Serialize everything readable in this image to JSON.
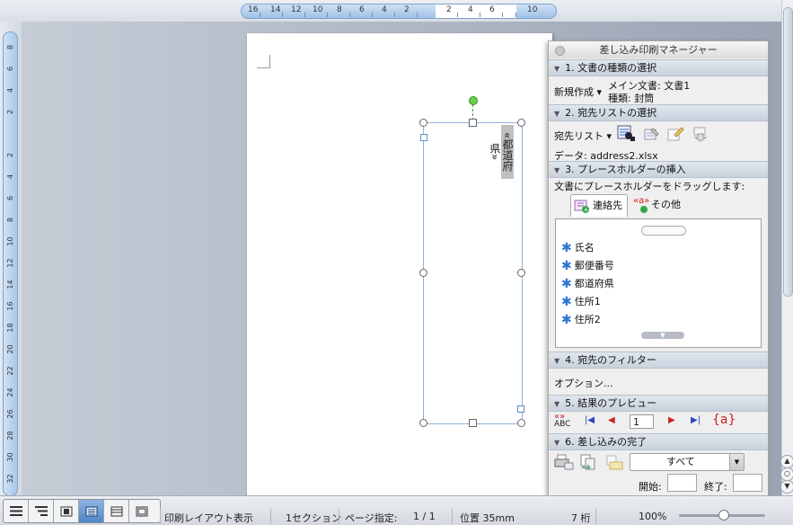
{
  "ruler": {
    "h_labels": [
      "16",
      "14",
      "12",
      "10",
      "8",
      "6",
      "4",
      "2",
      "2",
      "4",
      "6",
      "10"
    ],
    "v_labels": [
      "8",
      "6",
      "4",
      "2",
      "2",
      "4",
      "6",
      "8",
      "10",
      "12",
      "14",
      "16",
      "18",
      "20",
      "22",
      "24",
      "26",
      "28",
      "30",
      "32"
    ]
  },
  "document": {
    "textbox_placeholder": "«都道府県»"
  },
  "palette": {
    "title": "差し込み印刷マネージャー",
    "sections": [
      {
        "label": "1. 文書の種類の選択"
      },
      {
        "label": "2. 宛先リストの選択"
      },
      {
        "label": "3. プレースホルダーの挿入"
      },
      {
        "label": "4. 宛先のフィルター"
      },
      {
        "label": "5. 結果のプレビュー"
      },
      {
        "label": "6. 差し込みの完了"
      }
    ],
    "doc_type": {
      "new_button": "新規作成",
      "main_doc": "メイン文書: 文書1",
      "kind": "種類: 封筒"
    },
    "recipients": {
      "list_button": "宛先リスト",
      "data_source": "データ: address2.xlsx"
    },
    "placeholders": {
      "instruction": "文書にプレースホルダーをドラッグします:",
      "tab_contacts": "連絡先",
      "tab_other": "その他",
      "tab_other_icon_text": "«a»",
      "fields": [
        "氏名",
        "郵便番号",
        "都道府県",
        "住所1",
        "住所2"
      ]
    },
    "filter": {
      "options_label": "オプション..."
    },
    "preview": {
      "abc_icon_text": "ABC",
      "record_number": "1",
      "field_code_text": "{a}"
    },
    "complete": {
      "range_value": "すべて",
      "start_label": "開始:",
      "end_label": "終了:"
    }
  },
  "statusbar": {
    "view": "印刷レイアウト表示",
    "section": "1セクション",
    "page_label": "ページ指定:",
    "page_value": "1 / 1",
    "position": "位置 35mm",
    "column": "7 桁",
    "zoom": "100%"
  }
}
